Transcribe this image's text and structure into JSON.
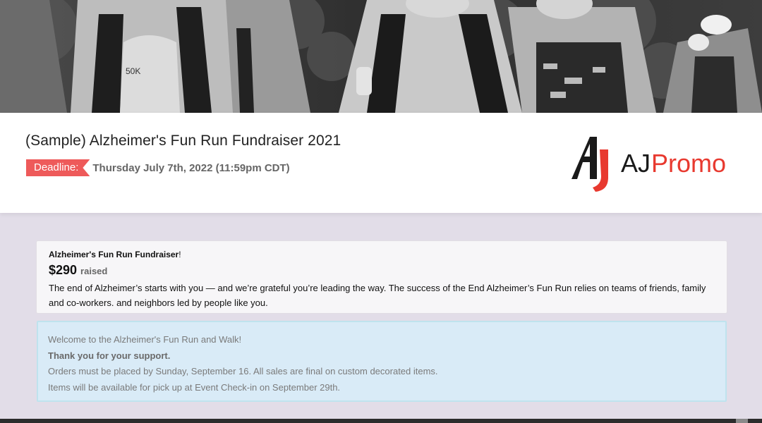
{
  "hero": {
    "image_description_icon": "runners-photo"
  },
  "header": {
    "title": "(Sample) Alzheimer's Fun Run Fundraiser 2021",
    "deadline_label": "Deadline:",
    "deadline_value": "Thursday July 7th, 2022 (11:59pm CDT)",
    "logo": {
      "prefix": "AJ",
      "suffix": "Promo",
      "accent_color": "#e8392f",
      "dark_color": "#1a1a1a"
    }
  },
  "fundraiser": {
    "heading": "Alzheimer's Fun Run Fundraiser",
    "heading_suffix": "!",
    "amount": "$290",
    "raised_label": "raised",
    "description": "The end of Alzheimer’s starts with you — and we’re grateful you’re leading the way. The success of the End Alzheimer’s Fun Run relies on teams of friends, family and co-workers. and neighbors led by people like you."
  },
  "info": {
    "line1": "Welcome to the Alzheimer's Fun Run and Walk!",
    "line2": "Thank you for your support.",
    "line3": "Orders must be placed by Sunday, September 16. All sales are final on custom decorated items.",
    "line4": "Items will be available for pick up at Event Check-in on September 29th."
  },
  "colors": {
    "page_bg": "#e2dde8",
    "deadline_tag": "#ee5a5a",
    "info_bg": "#d9ebf7",
    "info_border": "#bfe3ee"
  }
}
